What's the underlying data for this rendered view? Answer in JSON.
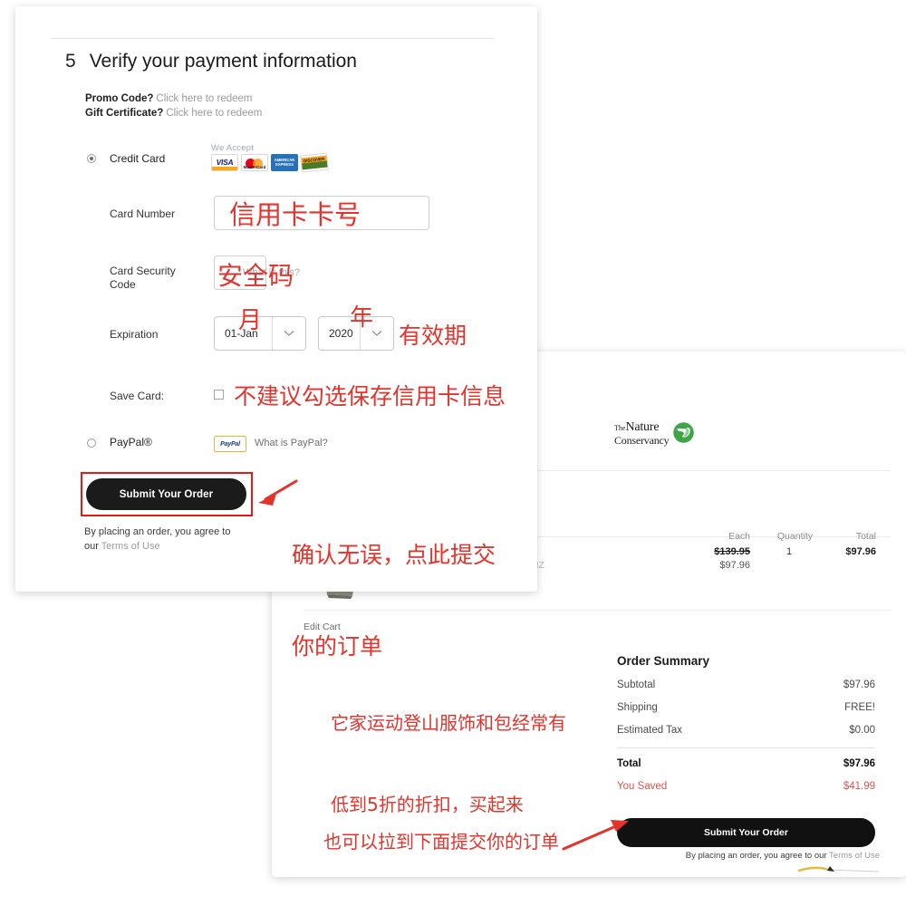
{
  "left_panel": {
    "step_number": "5",
    "step_title": "Verify your payment information",
    "promo": {
      "label": "Promo Code?",
      "link": "Click here to redeem"
    },
    "gift": {
      "label": "Gift Certificate?",
      "link": "Click here to redeem"
    },
    "payment_methods": [
      {
        "id": "credit-card",
        "label": "Credit Card",
        "selected": true
      },
      {
        "id": "paypal",
        "label": "PayPal®",
        "selected": false
      }
    ],
    "we_accept": {
      "label": "We Accept",
      "cards": [
        "VISA",
        "MasterCard",
        "AMERICAN EXPRESS",
        "DISCOVER"
      ]
    },
    "fields": {
      "card_number_label": "Card Number",
      "card_number_value": "",
      "security_code_label": "Card Security Code",
      "security_code_value": "",
      "what_is_this_link": "What is this?",
      "expiration_label": "Expiration",
      "expiration_month": "01-Jan",
      "expiration_year": "2020",
      "save_card_label": "Save Card:",
      "save_card_checked": false
    },
    "paypal": {
      "badge_text": "PayPal",
      "link": "What is PayPal?"
    },
    "submit_button": "Submit Your Order",
    "terms_prefix": "By placing an order, you agree to our",
    "terms_link": "Terms of Use"
  },
  "right_panel": {
    "brand": {
      "the": "The",
      "nature": "Nature",
      "conservancy": "Conservancy"
    },
    "cart_table": {
      "headers": [
        "Each",
        "Quantity",
        "Total"
      ],
      "row": {
        "size": "NESIZ",
        "each_original": "$139.95",
        "each_sale": "$97.96",
        "quantity": "1",
        "total": "$97.96"
      }
    },
    "edit_cart": "Edit Cart",
    "order_summary": {
      "title": "Order Summary",
      "rows": [
        {
          "label": "Subtotal",
          "value": "$97.96"
        },
        {
          "label": "Shipping",
          "value": "FREE!"
        },
        {
          "label": "Estimated Tax",
          "value": "$0.00"
        }
      ],
      "total": {
        "label": "Total",
        "value": "$97.96"
      },
      "saved": {
        "label": "You Saved",
        "value": "$41.99"
      }
    },
    "submit_button": "Submit Your Order",
    "terms_prefix": "By placing an order, you agree to our",
    "terms_link": "Terms of Use"
  },
  "annotations": {
    "card_number": "信用卡卡号",
    "security_code": "安全码",
    "month": "月",
    "year": "年",
    "expiration": "有效期",
    "save_card": "不建议勾选保存信用卡信息",
    "submit_line1": "确认无误，点此提交",
    "submit_line2": "你的订单",
    "discount_line1": "它家运动登山服饰和包经常有",
    "discount_line2": "低到5折的折扣，买起来",
    "scroll_hint": "也可以拉到下面提交你的订单"
  },
  "colors": {
    "annotation_red": "#e2342c",
    "highlight_red": "#e01b1b",
    "brand_green": "#3fa446",
    "button_black": "#1b1b1b",
    "saved_red": "#d9534f"
  }
}
